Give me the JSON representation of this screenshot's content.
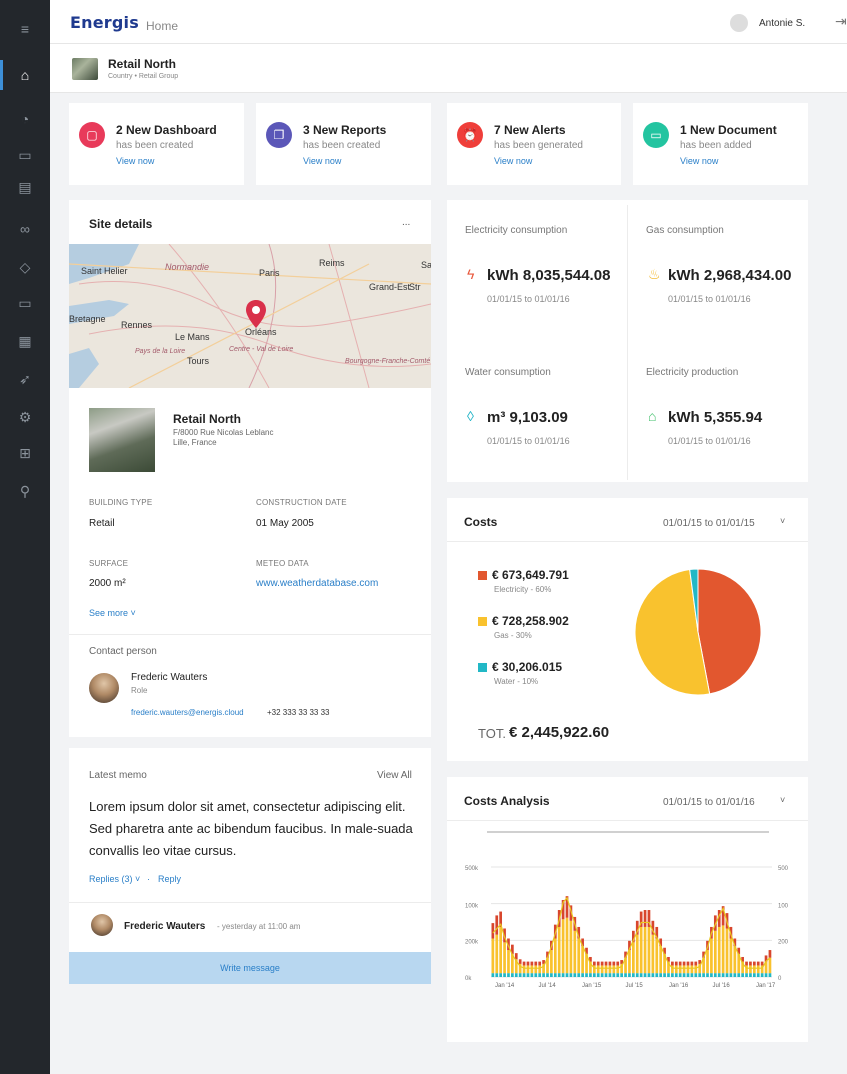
{
  "app": {
    "logo": "Energis",
    "section": "Home",
    "user": "Antonie S."
  },
  "sidebar": {
    "icons": [
      "menu-icon",
      "home-icon",
      "gauge-icon",
      "folder-icon",
      "briefcase-icon",
      "glasses-icon",
      "leaf-icon",
      "folder-open-icon",
      "calculator-icon",
      "rocket-icon",
      "settings-icon",
      "hierarchy-icon",
      "user-search-icon"
    ],
    "glyphs": [
      "≡",
      "⌂",
      "◔",
      "▭",
      "▤",
      "∞",
      "◇",
      "▭",
      "▦",
      "➶",
      "⚙",
      "⊞",
      "⚲"
    ]
  },
  "site": {
    "name": "Retail North",
    "breadcrumb": "Country • Retail Group"
  },
  "notifications": [
    {
      "title": "2 New Dashboard",
      "sub": "has been created",
      "link": "View now",
      "color": "#e83a5a",
      "icon": "dashboard-icon",
      "glyph": "▢"
    },
    {
      "title": "3 New Reports",
      "sub": "has been created",
      "link": "View now",
      "color": "#5b57b8",
      "icon": "report-icon",
      "glyph": "❐"
    },
    {
      "title": "7 New Alerts",
      "sub": "has been generated",
      "link": "View now",
      "color": "#ef3e3a",
      "icon": "alert-icon",
      "glyph": "⏰"
    },
    {
      "title": "1 New Document",
      "sub": "has been added",
      "link": "View now",
      "color": "#23c4a0",
      "icon": "document-icon",
      "glyph": "▭"
    }
  ],
  "site_details": {
    "title": "Site details",
    "more": "...",
    "map_labels": [
      "Saint Helier",
      "Normandie",
      "Paris",
      "Reims",
      "Grand-Est",
      "Str",
      "Bretagne",
      "Rennes",
      "Le Mans",
      "Orléans",
      "Pays de la Loire",
      "Tours",
      "Centre - Val de Loire",
      "Bourgogne-Franche-Comté",
      "Sa"
    ],
    "building_name": "Retail North",
    "address1": "F/8000 Rue Nicolas Leblanc",
    "address2": "Lille, France",
    "building_type_label": "BUILDING TYPE",
    "building_type": "Retail",
    "construction_label": "CONSTRUCTION DATE",
    "construction": "01 May 2005",
    "surface_label": "SURFACE",
    "surface": "2000 m²",
    "meteo_label": "METEO DATA",
    "meteo": "www.weatherdatabase.com",
    "see_more": "See more ˅",
    "contact_label": "Contact person",
    "contact_name": "Frederic Wauters",
    "contact_role": "Role",
    "contact_email": "frederic.wauters@energis.cloud",
    "contact_phone": "+32 333 33 33 33"
  },
  "consumption": [
    {
      "label": "Electricity consumption",
      "value": "kWh 8,035,544.08",
      "date": "01/01/15  to  01/01/16",
      "icon": "lightning-icon",
      "glyph": "ϟ",
      "color": "#e8573b"
    },
    {
      "label": "Gas consumption",
      "value": "kWh 2,968,434.00",
      "date": "01/01/15  to  01/01/16",
      "icon": "flame-icon",
      "glyph": "♨",
      "color": "#f2b31c"
    },
    {
      "label": "Water consumption",
      "value": "m³ 9,103.09",
      "date": "01/01/15  to  01/01/16",
      "icon": "drop-icon",
      "glyph": "◊",
      "color": "#1fb3c6"
    },
    {
      "label": "Electricity production",
      "value": "kWh 5,355.94",
      "date": "01/01/15  to  01/01/16",
      "icon": "house-icon",
      "glyph": "⌂",
      "color": "#3fbf6a"
    }
  ],
  "costs": {
    "title": "Costs",
    "range": "01/01/15  to  01/01/15",
    "items": [
      {
        "value": "€ 673,649.791",
        "sub": "Electricity - 60%",
        "color": "#e2572f"
      },
      {
        "value": "€ 728,258.902",
        "sub": "Gas - 30%",
        "color": "#f9c22e"
      },
      {
        "value": "€ 30,206.015",
        "sub": "Water - 10%",
        "color": "#22b8c6"
      }
    ],
    "total_label": "TOT.",
    "total": "€ 2,445,922.60"
  },
  "memo": {
    "title": "Latest memo",
    "view_all": "View All",
    "text": "Lorem ipsum dolor sit amet, consectetur adipiscing elit. Sed pharetra ante ac bibendum faucibus. In male-suada convallis leo vitae cursus.",
    "replies": "Replies (3) ˅",
    "sep": "·",
    "reply": "Reply",
    "author": "Frederic Wauters",
    "time": "- yesterday at 11:00 am",
    "write": "Write message"
  },
  "analysis": {
    "title": "Costs Analysis",
    "range": "01/01/15 to 01/01/16"
  },
  "chart_data": [
    {
      "type": "pie",
      "categories": [
        "Electricity",
        "Gas",
        "Water"
      ],
      "values": [
        673649.791,
        728258.902,
        30206.015
      ],
      "colors": [
        "#e2572f",
        "#f9c22e",
        "#22b8c6"
      ]
    },
    {
      "type": "bar",
      "y_ticks_left": [
        "0k",
        "200k",
        "100k",
        "500k"
      ],
      "y_ticks_right": [
        "0",
        "200",
        "100",
        "500"
      ],
      "x_ticks": [
        "Jan '14",
        "Jul '14",
        "Jan '15",
        "Jul '15",
        "Jan '16",
        "Jul '16",
        "Jan '17"
      ],
      "series": [
        {
          "values": [
            5,
            5,
            5,
            5,
            5,
            5,
            5,
            5,
            5,
            5,
            5,
            5,
            5,
            5,
            5,
            5,
            5,
            5,
            5,
            5,
            5,
            5,
            5,
            5,
            5,
            5,
            5,
            5,
            5,
            5,
            5,
            5,
            5,
            5,
            5,
            5,
            5,
            5,
            5,
            5,
            5,
            5,
            5,
            5,
            5,
            5,
            5,
            5,
            5,
            5,
            5,
            5,
            5,
            5,
            5,
            5,
            5,
            5,
            5,
            5,
            5,
            5,
            5,
            5,
            5,
            5,
            5,
            5,
            5,
            5,
            5,
            5
          ],
          "color": "#22b8c6"
        },
        {
          "values": [
            45,
            50,
            60,
            40,
            30,
            25,
            18,
            12,
            10,
            10,
            10,
            10,
            10,
            12,
            20,
            30,
            45,
            60,
            70,
            72,
            68,
            55,
            45,
            35,
            25,
            15,
            10,
            10,
            10,
            10,
            10,
            10,
            10,
            12,
            20,
            30,
            40,
            50,
            60,
            60,
            60,
            50,
            45,
            35,
            25,
            15,
            10,
            10,
            10,
            10,
            10,
            10,
            10,
            12,
            20,
            30,
            45,
            55,
            60,
            62,
            58,
            45,
            35,
            25,
            15,
            10,
            10,
            10,
            10,
            10,
            15,
            20
          ],
          "color": "#f9c22e"
        },
        {
          "values": [
            20,
            25,
            20,
            18,
            15,
            12,
            8,
            6,
            5,
            5,
            5,
            5,
            5,
            5,
            8,
            12,
            18,
            22,
            25,
            28,
            20,
            18,
            15,
            10,
            8,
            6,
            5,
            5,
            5,
            5,
            5,
            5,
            5,
            5,
            8,
            12,
            15,
            18,
            20,
            22,
            22,
            18,
            15,
            10,
            8,
            6,
            5,
            5,
            5,
            5,
            5,
            5,
            5,
            5,
            8,
            12,
            15,
            20,
            22,
            25,
            20,
            15,
            10,
            8,
            6,
            5,
            5,
            5,
            5,
            5,
            8,
            10
          ],
          "color": "#d8462d"
        }
      ],
      "line": [
        50,
        55,
        60,
        45,
        35,
        25,
        18,
        12,
        10,
        10,
        10,
        10,
        10,
        12,
        22,
        35,
        50,
        65,
        85,
        90,
        75,
        60,
        45,
        35,
        25,
        15,
        10,
        10,
        10,
        10,
        10,
        10,
        10,
        12,
        22,
        32,
        42,
        52,
        62,
        62,
        62,
        52,
        45,
        35,
        25,
        15,
        10,
        10,
        10,
        10,
        10,
        10,
        10,
        12,
        22,
        34,
        50,
        60,
        70,
        78,
        62,
        48,
        35,
        25,
        15,
        10,
        10,
        10,
        10,
        10,
        18,
        22
      ],
      "line_color": "#e8c820"
    }
  ]
}
